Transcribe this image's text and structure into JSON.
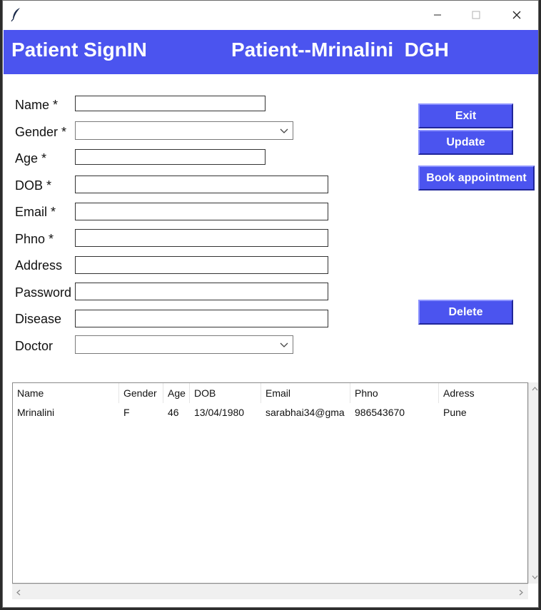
{
  "header": {
    "title_left": "Patient SignIN",
    "title_right": "Patient--Mrinalini  DGH"
  },
  "form": {
    "name_label": "Name *",
    "gender_label": "Gender *",
    "age_label": "Age *",
    "dob_label": "DOB *",
    "email_label": "Email *",
    "phno_label": "Phno *",
    "address_label": "Address",
    "password_label": "Password",
    "disease_label": "Disease",
    "doctor_label": "Doctor",
    "gender_value": "",
    "doctor_value": ""
  },
  "buttons": {
    "exit": "Exit",
    "update": "Update",
    "book": "Book appointment",
    "delete": "Delete"
  },
  "table": {
    "columns": [
      "Name",
      "Gender",
      "Age",
      "DOB",
      "Email",
      "Phno",
      "Adress"
    ],
    "rows": [
      [
        "Mrinalini",
        "F",
        "46",
        "13/04/1980",
        "sarabhai34@gma",
        "986543670",
        "Pune"
      ]
    ]
  },
  "colors": {
    "accent": "#4b54ef",
    "window_bg": "#ffffff",
    "text": "#111111"
  },
  "icons": {
    "app": "feather-icon",
    "minimize": "minimize-icon",
    "maximize": "maximize-icon",
    "close": "close-icon",
    "dropdown": "chevron-down-icon"
  }
}
